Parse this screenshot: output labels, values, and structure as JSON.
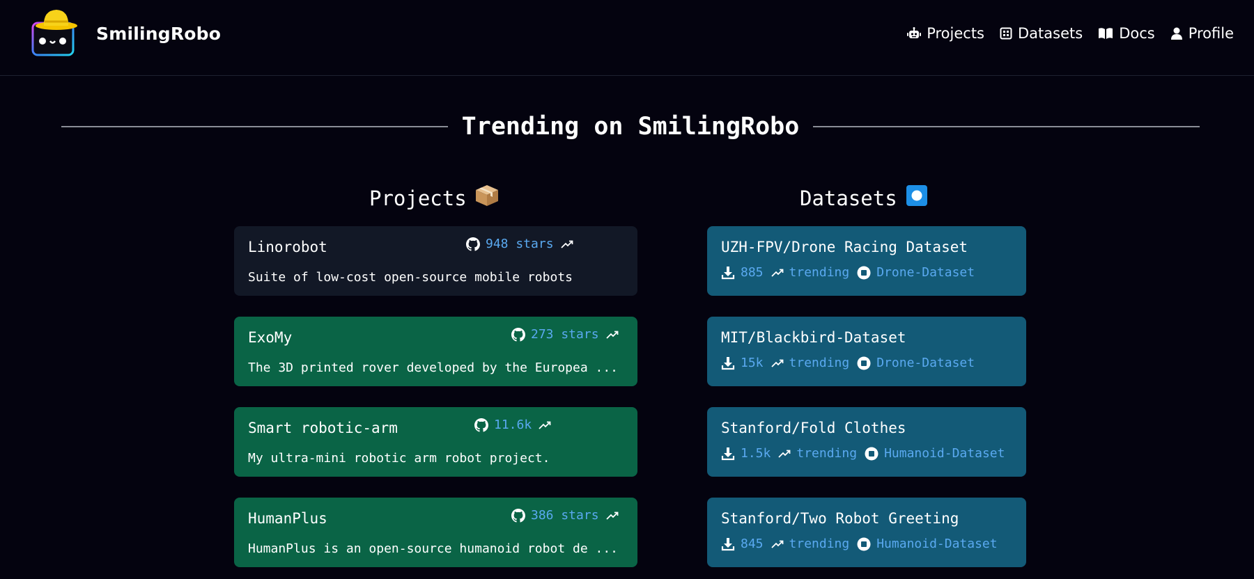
{
  "brand": {
    "name": "SmilingRobo"
  },
  "nav": [
    {
      "label": "Projects",
      "icon": "robot-icon"
    },
    {
      "label": "Datasets",
      "icon": "grid-icon"
    },
    {
      "label": "Docs",
      "icon": "book-icon"
    },
    {
      "label": "Profile",
      "icon": "user-icon"
    }
  ],
  "main": {
    "title": "Trending on SmilingRobo",
    "projects_title": "Projects",
    "datasets_title": "Datasets"
  },
  "projects": [
    {
      "name": "Linorobot",
      "stars": "948 stars",
      "description": "Suite of low-cost open-source mobile robots",
      "style": "dark"
    },
    {
      "name": "ExoMy",
      "stars": "273 stars",
      "description": "The 3D printed rover developed by the Europea ...",
      "style": "green"
    },
    {
      "name": "Smart robotic-arm",
      "stars": "11.6k",
      "description": "My ultra-mini robotic arm robot project.",
      "style": "green"
    },
    {
      "name": "HumanPlus",
      "stars": "386 stars",
      "description": "HumanPlus is an open-source humanoid robot de ...",
      "style": "green"
    }
  ],
  "datasets": [
    {
      "name": "UZH-FPV/Drone Racing Dataset",
      "downloads": "885",
      "trend": "trending",
      "tag": "Drone-Dataset"
    },
    {
      "name": "MIT/Blackbird-Dataset",
      "downloads": "15k",
      "trend": "trending",
      "tag": "Drone-Dataset"
    },
    {
      "name": "Stanford/Fold Clothes",
      "downloads": "1.5k",
      "trend": "trending",
      "tag": "Humanoid-Dataset"
    },
    {
      "name": "Stanford/Two Robot Greeting",
      "downloads": "845",
      "trend": "trending",
      "tag": "Humanoid-Dataset"
    }
  ],
  "colors": {
    "background": "#04030f",
    "project_dark": "#121826",
    "project_green": "#0a6446",
    "dataset_card": "#135a77",
    "link_blue": "#5aa9f0"
  }
}
